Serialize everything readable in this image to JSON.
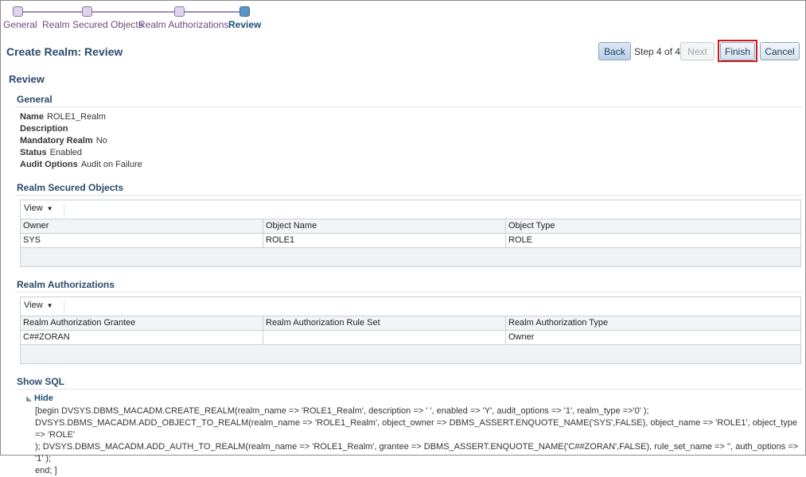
{
  "train": {
    "steps": [
      {
        "label": "General"
      },
      {
        "label": "Realm Secured Objects"
      },
      {
        "label": "Realm Authorizations"
      },
      {
        "label": "Review"
      }
    ]
  },
  "page_title": "Create Realm: Review",
  "buttons": {
    "back": "Back",
    "step_text": "Step 4 of 4",
    "next": "Next",
    "finish": "Finish",
    "cancel": "Cancel"
  },
  "review_heading": "Review",
  "general": {
    "heading": "General",
    "fields": [
      {
        "key": "Name",
        "value": "ROLE1_Realm"
      },
      {
        "key": "Description",
        "value": ""
      },
      {
        "key": "Mandatory Realm",
        "value": "No"
      },
      {
        "key": "Status",
        "value": "Enabled"
      },
      {
        "key": "Audit Options",
        "value": "Audit on Failure"
      }
    ]
  },
  "secured_objects": {
    "heading": "Realm Secured Objects",
    "view_label": "View",
    "columns": [
      "Owner",
      "Object Name",
      "Object Type"
    ],
    "rows": [
      [
        "SYS",
        "ROLE1",
        "ROLE"
      ]
    ]
  },
  "authorizations": {
    "heading": "Realm Authorizations",
    "view_label": "View",
    "columns": [
      "Realm Authorization Grantee",
      "Realm Authorization Rule Set",
      "Realm Authorization Type"
    ],
    "rows": [
      [
        "C##ZORAN",
        "",
        "Owner"
      ]
    ]
  },
  "show_sql": {
    "heading": "Show SQL",
    "hide_label": "Hide",
    "lines": [
      "[begin DVSYS.DBMS_MACADM.CREATE_REALM(realm_name => 'ROLE1_Realm', description => ' ', enabled => 'Y', audit_options => '1', realm_type =>'0' );",
      "DVSYS.DBMS_MACADM.ADD_OBJECT_TO_REALM(realm_name => 'ROLE1_Realm', object_owner => DBMS_ASSERT.ENQUOTE_NAME('SYS',FALSE), object_name => 'ROLE1', object_type => 'ROLE'",
      "); DVSYS.DBMS_MACADM.ADD_AUTH_TO_REALM(realm_name => 'ROLE1_Realm', grantee => DBMS_ASSERT.ENQUOTE_NAME('C##ZORAN',FALSE), rule_set_name => '', auth_options => '1' );",
      "end; ]"
    ]
  },
  "colors": {
    "accent": "#2b4a6b",
    "finish_highlight": "#cc1b1b",
    "train_current": "#5c95c5"
  }
}
